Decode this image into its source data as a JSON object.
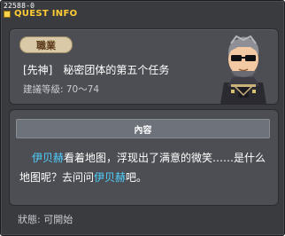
{
  "quest_id": "22588-0",
  "window_title": "QUEST INFO",
  "job_label": "職業",
  "quest_name": "[先神]　秘密团体的第五个任务",
  "recommended_level": "建議等級: 70～74",
  "npc_icon": "npc-portrait-sunglasses-suit",
  "content": {
    "header": "內容",
    "npc_name": "伊贝赫",
    "text_part1": "看着地图，浮现出了满意的微笑……是什么地图呢？去问问",
    "text_part2": "吧。"
  },
  "status": "狀態: 可開始",
  "colors": {
    "title": "#ffcc33",
    "highlight": "#4fd0ff",
    "panel": "#4c4e53",
    "window": "#3a3b3f"
  }
}
